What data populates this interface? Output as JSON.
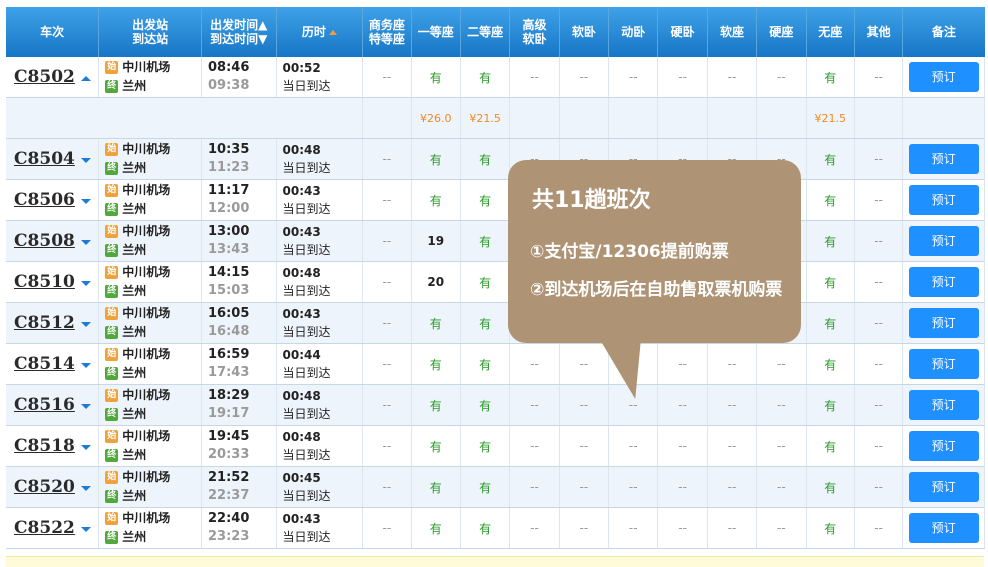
{
  "headers": {
    "train": "车次",
    "stations": [
      "出发站",
      "到达站"
    ],
    "times": [
      "出发时间▲",
      "到达时间▼"
    ],
    "duration": "历时",
    "business": [
      "商务座",
      "特等座"
    ],
    "first": "一等座",
    "second": "二等座",
    "premium_sleeper": [
      "高级",
      "软卧"
    ],
    "soft_sleeper": "软卧",
    "motor_sleeper": "动卧",
    "hard_sleeper": "硬卧",
    "soft_seat": "软座",
    "hard_seat": "硬座",
    "no_seat": "无座",
    "other": "其他",
    "note": "备注"
  },
  "badges": {
    "start": "始",
    "end": "终"
  },
  "book_label": "预订",
  "rows": [
    {
      "train": "C8502",
      "from": "中川机场",
      "to": "兰州",
      "dep": "08:46",
      "arr": "09:38",
      "dur": "00:52",
      "day": "当日到达",
      "business": "--",
      "first": "有",
      "second": "有",
      "premium": "--",
      "soft": "--",
      "motor": "--",
      "hard_sleep": "--",
      "soft_seat": "--",
      "hard_seat": "--",
      "noseat": "有",
      "other": "--"
    },
    {
      "train": "C8504",
      "from": "中川机场",
      "to": "兰州",
      "dep": "10:35",
      "arr": "11:23",
      "dur": "00:48",
      "day": "当日到达",
      "business": "--",
      "first": "有",
      "second": "有",
      "premium": "--",
      "soft": "--",
      "motor": "--",
      "hard_sleep": "--",
      "soft_seat": "--",
      "hard_seat": "--",
      "noseat": "有",
      "other": "--"
    },
    {
      "train": "C8506",
      "from": "中川机场",
      "to": "兰州",
      "dep": "11:17",
      "arr": "12:00",
      "dur": "00:43",
      "day": "当日到达",
      "business": "--",
      "first": "有",
      "second": "有",
      "premium": "--",
      "soft": "--",
      "motor": "--",
      "hard_sleep": "--",
      "soft_seat": "--",
      "hard_seat": "--",
      "noseat": "有",
      "other": "--"
    },
    {
      "train": "C8508",
      "from": "中川机场",
      "to": "兰州",
      "dep": "13:00",
      "arr": "13:43",
      "dur": "00:43",
      "day": "当日到达",
      "business": "--",
      "first": "19",
      "second": "有",
      "premium": "--",
      "soft": "--",
      "motor": "--",
      "hard_sleep": "--",
      "soft_seat": "--",
      "hard_seat": "--",
      "noseat": "有",
      "other": "--"
    },
    {
      "train": "C8510",
      "from": "中川机场",
      "to": "兰州",
      "dep": "14:15",
      "arr": "15:03",
      "dur": "00:48",
      "day": "当日到达",
      "business": "--",
      "first": "20",
      "second": "有",
      "premium": "--",
      "soft": "--",
      "motor": "--",
      "hard_sleep": "--",
      "soft_seat": "--",
      "hard_seat": "--",
      "noseat": "有",
      "other": "--"
    },
    {
      "train": "C8512",
      "from": "中川机场",
      "to": "兰州",
      "dep": "16:05",
      "arr": "16:48",
      "dur": "00:43",
      "day": "当日到达",
      "business": "--",
      "first": "有",
      "second": "有",
      "premium": "--",
      "soft": "--",
      "motor": "--",
      "hard_sleep": "--",
      "soft_seat": "--",
      "hard_seat": "--",
      "noseat": "有",
      "other": "--"
    },
    {
      "train": "C8514",
      "from": "中川机场",
      "to": "兰州",
      "dep": "16:59",
      "arr": "17:43",
      "dur": "00:44",
      "day": "当日到达",
      "business": "--",
      "first": "有",
      "second": "有",
      "premium": "--",
      "soft": "--",
      "motor": "--",
      "hard_sleep": "--",
      "soft_seat": "--",
      "hard_seat": "--",
      "noseat": "有",
      "other": "--"
    },
    {
      "train": "C8516",
      "from": "中川机场",
      "to": "兰州",
      "dep": "18:29",
      "arr": "19:17",
      "dur": "00:48",
      "day": "当日到达",
      "business": "--",
      "first": "有",
      "second": "有",
      "premium": "--",
      "soft": "--",
      "motor": "--",
      "hard_sleep": "--",
      "soft_seat": "--",
      "hard_seat": "--",
      "noseat": "有",
      "other": "--"
    },
    {
      "train": "C8518",
      "from": "中川机场",
      "to": "兰州",
      "dep": "19:45",
      "arr": "20:33",
      "dur": "00:48",
      "day": "当日到达",
      "business": "--",
      "first": "有",
      "second": "有",
      "premium": "--",
      "soft": "--",
      "motor": "--",
      "hard_sleep": "--",
      "soft_seat": "--",
      "hard_seat": "--",
      "noseat": "有",
      "other": "--"
    },
    {
      "train": "C8520",
      "from": "中川机场",
      "to": "兰州",
      "dep": "21:52",
      "arr": "22:37",
      "dur": "00:45",
      "day": "当日到达",
      "business": "--",
      "first": "有",
      "second": "有",
      "premium": "--",
      "soft": "--",
      "motor": "--",
      "hard_sleep": "--",
      "soft_seat": "--",
      "hard_seat": "--",
      "noseat": "有",
      "other": "--"
    },
    {
      "train": "C8522",
      "from": "中川机场",
      "to": "兰州",
      "dep": "22:40",
      "arr": "23:23",
      "dur": "00:43",
      "day": "当日到达",
      "business": "--",
      "first": "有",
      "second": "有",
      "premium": "--",
      "soft": "--",
      "motor": "--",
      "hard_sleep": "--",
      "soft_seat": "--",
      "hard_seat": "--",
      "noseat": "有",
      "other": "--"
    }
  ],
  "price_row": {
    "first": "¥26.0",
    "second": "¥21.5",
    "noseat": "¥21.5"
  },
  "overlay": {
    "title": "共11趟班次",
    "line1": "①支付宝/12306提前购票",
    "line2": "②到达机场后在自助售取票机购票"
  },
  "colors": {
    "header": "#1e82d2",
    "button": "#1e90ff",
    "available": "#2a9a2a",
    "price": "#f08a24",
    "overlay": "#ae9475"
  }
}
